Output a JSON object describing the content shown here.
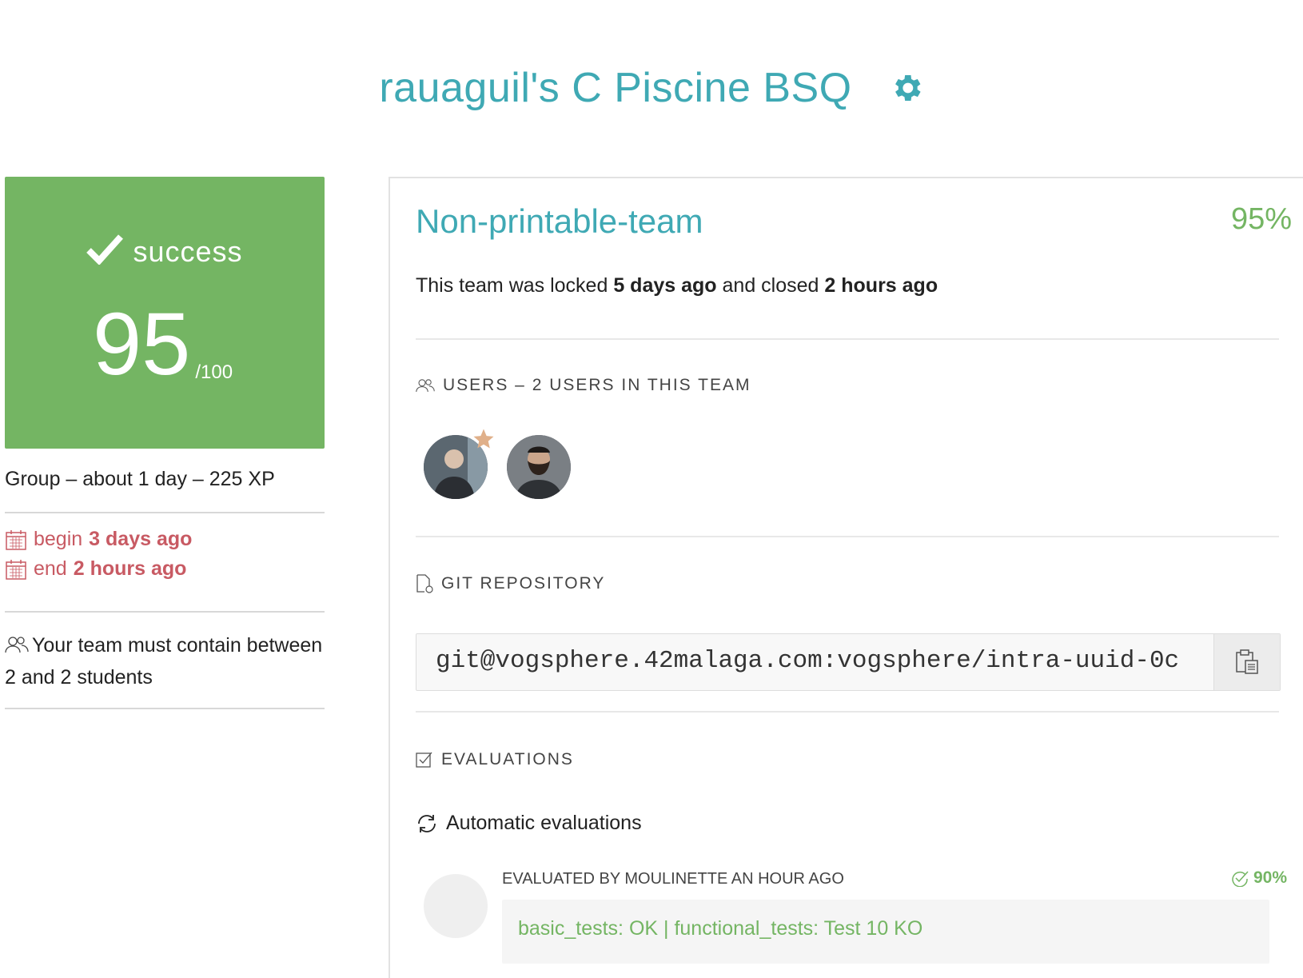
{
  "header": {
    "title": "rauaguil's C Piscine BSQ",
    "settings_icon": "gear-icon"
  },
  "grade": {
    "status": "success",
    "score": "95",
    "max": "/100",
    "color": "#74b563"
  },
  "project_meta": {
    "summary": "Group – about 1 day – 225 XP",
    "begin_label": "begin",
    "begin_value": "3 days ago",
    "end_label": "end",
    "end_value": "2 hours ago",
    "team_requirement": "Your team must contain between 2 and 2 students"
  },
  "team": {
    "name": "Non-printable-team",
    "percent": "95%",
    "locked_prefix": "This team was locked",
    "locked_value": "5 days ago",
    "closed_prefix": "and closed",
    "closed_value": "2 hours ago"
  },
  "users_section": {
    "label": "USERS – 2 USERS IN THIS TEAM"
  },
  "git_section": {
    "label": "GIT REPOSITORY",
    "url": "git@vogsphere.42malaga.com:vogsphere/intra-uuid-0c"
  },
  "evaluations_section": {
    "label": "EVALUATIONS",
    "auto_title": "Automatic evaluations",
    "evaluated_by": "EVALUATED BY MOULINETTE AN HOUR AGO",
    "score": "90%",
    "result": "basic_tests: OK | functional_tests: Test 10 KO"
  },
  "colors": {
    "accent": "#3fa9b4",
    "success": "#74b563",
    "date": "#c85a63"
  }
}
